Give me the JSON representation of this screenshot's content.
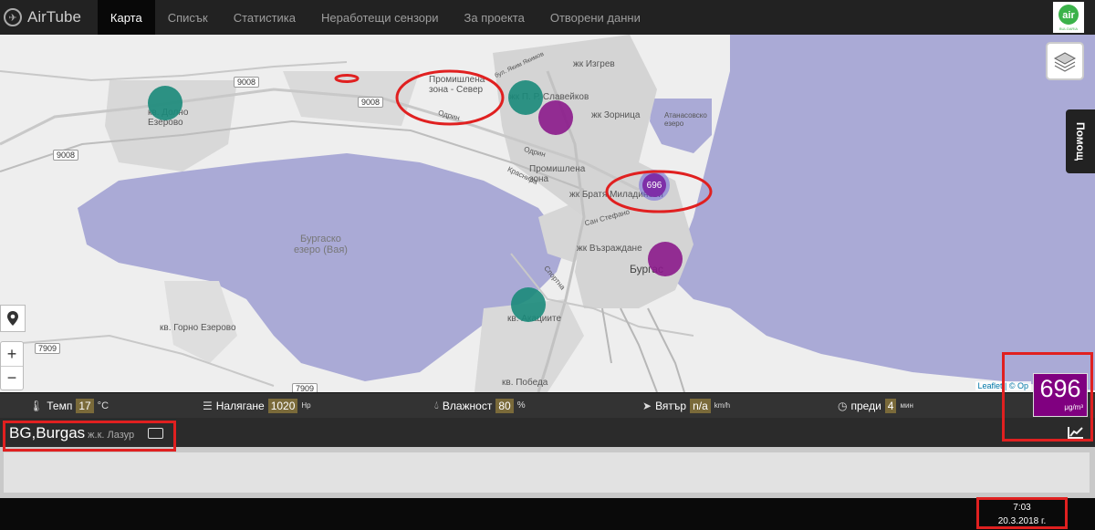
{
  "navbar": {
    "brand": "AirTube",
    "items": [
      {
        "label": "Карта",
        "active": true
      },
      {
        "label": "Списък",
        "active": false
      },
      {
        "label": "Статистика",
        "active": false
      },
      {
        "label": "Неработещи сензори",
        "active": false
      },
      {
        "label": "За проекта",
        "active": false
      },
      {
        "label": "Отворени данни",
        "active": false
      }
    ],
    "logo_text": "air",
    "logo_sub": "BULGARIA"
  },
  "map": {
    "labels": {
      "dolno": "кв. Долно\nЕзерово",
      "prom_sever": "Промишлена\nзона - Север",
      "izgrev": "жк Изгрев",
      "slaveikov": "жк П. Р. Славейков",
      "zornica": "жк Зорница",
      "atanasovsko": "Атанасовско\nезеро",
      "prom_zona": "Промишлена\nзона",
      "bratya": "жк Братя Миладинови",
      "lake": "Бургаско\nезеро (Вая)",
      "vazrazhdane": "жк Възраждане",
      "burgas": "Бургас",
      "gorno": "кв. Горно Езерово",
      "akaciite": "кв. Акациите",
      "pobeda": "кв. Победа",
      "odrin": "Одрин",
      "krasnira": "Краснира",
      "san_stefano": "Сан Стефано",
      "sportna": "Спортна",
      "odrin2": "Одрин",
      "bul_yakim": "бул. Яким Якимов"
    },
    "road_shields": [
      "9008",
      "9008",
      "9008",
      "7909",
      "7909"
    ],
    "cluster_count": "696",
    "attribution": "Leaflet | © Op",
    "help_label": "Помощ",
    "zoom_in": "+",
    "zoom_out": "−",
    "marker_colors": {
      "teal": "#1a8a7a",
      "purple": "#8b1a8b"
    }
  },
  "value_box": {
    "value": "696",
    "unit": "μg/m³",
    "color": "#800080"
  },
  "weather": {
    "temp_label": "Темп",
    "temp_value": "17",
    "temp_unit": "°C",
    "pressure_label": "Налягане",
    "pressure_value": "1020",
    "pressure_unit": "Hp",
    "humidity_label": "Влажност",
    "humidity_value": "80",
    "humidity_unit": "%",
    "wind_label": "Вятър",
    "wind_value": "n/a",
    "wind_unit": "km/h",
    "ago_label": "преди",
    "ago_value": "4",
    "ago_unit": "мин"
  },
  "station": {
    "name": "BG,Burgas",
    "sub": "ж.к. Лазур"
  },
  "clock": {
    "time": "7:03",
    "date": "20.3.2018 г."
  }
}
